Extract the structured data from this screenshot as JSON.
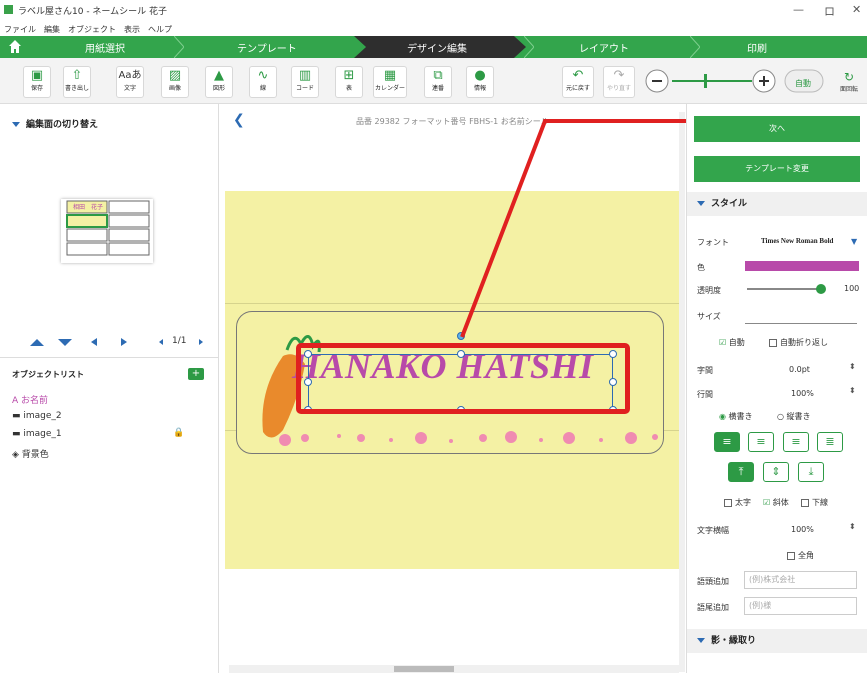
{
  "window": {
    "title": "ラベル屋さん10 - ネームシール 花子",
    "min": "—",
    "max": "ロ",
    "close": "✕"
  },
  "menu": [
    "ファイル",
    "編集",
    "オブジェクト",
    "表示",
    "ヘルプ"
  ],
  "steps": [
    "用紙選択",
    "テンプレート",
    "デザイン編集",
    "レイアウト",
    "印刷"
  ],
  "toolbar": {
    "buttons": [
      {
        "label": "保存",
        "icon": "save-icon"
      },
      {
        "label": "書き出し",
        "icon": "export-icon"
      },
      {
        "label": "文字",
        "icon": "text-icon",
        "glyph": "Aaあ"
      },
      {
        "label": "画像",
        "icon": "image-icon"
      },
      {
        "label": "図形",
        "icon": "shape-icon"
      },
      {
        "label": "線",
        "icon": "line-icon"
      },
      {
        "label": "コード",
        "icon": "barcode-icon"
      },
      {
        "label": "表",
        "icon": "table-icon"
      },
      {
        "label": "カレンダー",
        "icon": "calendar-icon"
      },
      {
        "label": "連番",
        "icon": "sequence-icon"
      },
      {
        "label": "情報",
        "icon": "person-icon"
      },
      {
        "label": "元に戻す",
        "icon": "undo-icon"
      },
      {
        "label": "やり直す",
        "icon": "redo-icon"
      }
    ],
    "zoom_auto": "自動",
    "rotate_label": "面回転"
  },
  "left": {
    "section": "編集面の切り替え",
    "thumb_text": "相田　花子",
    "page": "1/1",
    "objects_title": "オブジェクトリスト",
    "objects": [
      {
        "icon": "A",
        "name": "お名前"
      },
      {
        "icon": "▬",
        "name": "image_2"
      },
      {
        "icon": "▬",
        "name": "image_1",
        "locked": true
      },
      {
        "icon": "◈",
        "name": "背景色"
      }
    ]
  },
  "canvas": {
    "info": "品番 29382 フォーマット番号 FBHS-1 お名前シール",
    "name_text": "HANAKO HATSHI"
  },
  "right": {
    "next": "次へ",
    "template_change": "テンプレート変更",
    "style": "スタイル",
    "font_label": "フォント",
    "font_value": "Times New Roman Bold",
    "color_label": "色",
    "color": "#b84aa9",
    "opacity_label": "透明度",
    "opacity_value": "100",
    "size_label": "サイズ",
    "auto": "自動",
    "auto_wrap": "自動折り返し",
    "char_spacing_label": "字間",
    "char_spacing": "0.0pt",
    "line_spacing_label": "行間",
    "line_spacing": "100%",
    "horizontal": "横書き",
    "vertical": "縦書き",
    "bold": "太字",
    "italic": "斜体",
    "underline": "下線",
    "char_width_label": "文字横幅",
    "char_width": "100%",
    "fullwidth": "全角",
    "prefix_label": "語頭追加",
    "prefix_ph": "(例)株式会社",
    "suffix_label": "語尾追加",
    "suffix_ph": "(例)様",
    "shadow": "影・縁取り"
  }
}
